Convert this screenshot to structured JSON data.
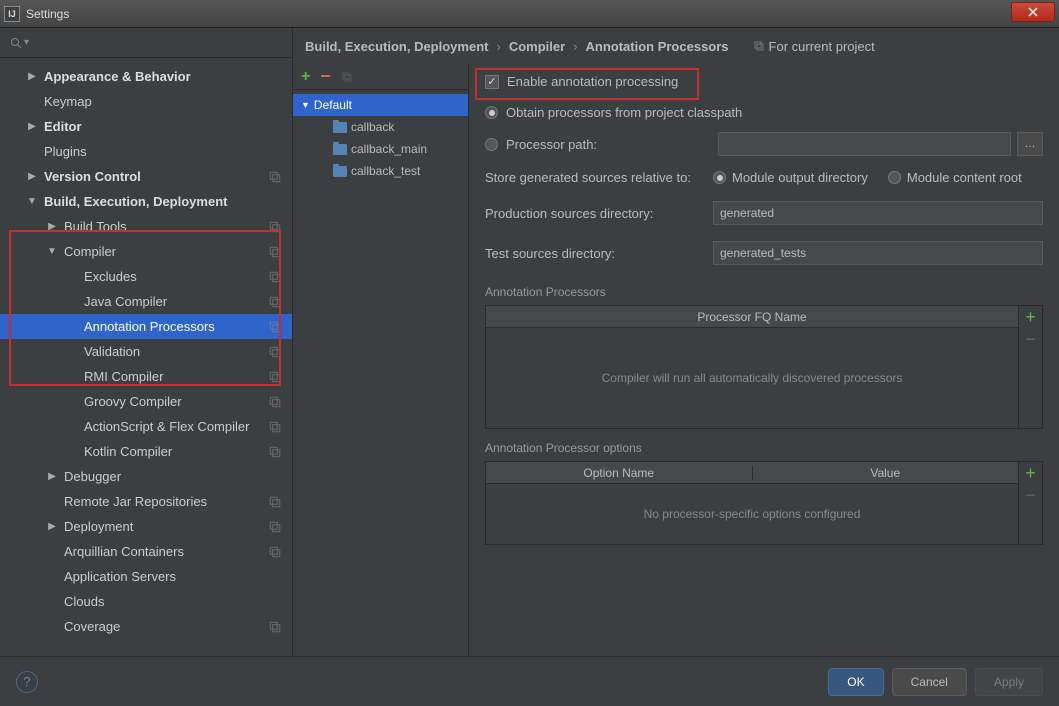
{
  "window": {
    "title": "Settings"
  },
  "search": {
    "placeholder": ""
  },
  "sidebar": {
    "items": [
      {
        "label": "Appearance & Behavior",
        "bold": true,
        "arrow": "right",
        "indent": 1
      },
      {
        "label": "Keymap",
        "indent": 1
      },
      {
        "label": "Editor",
        "bold": true,
        "arrow": "right",
        "indent": 1
      },
      {
        "label": "Plugins",
        "indent": 1
      },
      {
        "label": "Version Control",
        "bold": true,
        "arrow": "right",
        "indent": 1,
        "copy": true
      },
      {
        "label": "Build, Execution, Deployment",
        "bold": true,
        "arrow": "down",
        "indent": 1
      },
      {
        "label": "Build Tools",
        "arrow": "right",
        "indent": 2,
        "copy": true
      },
      {
        "label": "Compiler",
        "arrow": "down",
        "indent": 2,
        "copy": true
      },
      {
        "label": "Excludes",
        "indent": 3,
        "copy": true
      },
      {
        "label": "Java Compiler",
        "indent": 3,
        "copy": true
      },
      {
        "label": "Annotation Processors",
        "indent": 3,
        "copy": true,
        "selected": true
      },
      {
        "label": "Validation",
        "indent": 3,
        "copy": true
      },
      {
        "label": "RMI Compiler",
        "indent": 3,
        "copy": true
      },
      {
        "label": "Groovy Compiler",
        "indent": 3,
        "copy": true
      },
      {
        "label": "ActionScript & Flex Compiler",
        "indent": 3,
        "copy": true
      },
      {
        "label": "Kotlin Compiler",
        "indent": 3,
        "copy": true
      },
      {
        "label": "Debugger",
        "arrow": "right",
        "indent": 2
      },
      {
        "label": "Remote Jar Repositories",
        "indent": 2,
        "copy": true
      },
      {
        "label": "Deployment",
        "arrow": "right",
        "indent": 2,
        "copy": true
      },
      {
        "label": "Arquillian Containers",
        "indent": 2,
        "copy": true
      },
      {
        "label": "Application Servers",
        "indent": 2
      },
      {
        "label": "Clouds",
        "indent": 2
      },
      {
        "label": "Coverage",
        "indent": 2,
        "copy": true
      }
    ]
  },
  "breadcrumb": {
    "path": [
      "Build, Execution, Deployment",
      "Compiler",
      "Annotation Processors"
    ],
    "hint": "For current project"
  },
  "modules": {
    "default": "Default",
    "children": [
      "callback",
      "callback_main",
      "callback_test"
    ]
  },
  "panel": {
    "enable_label": "Enable annotation processing",
    "obtain_label": "Obtain processors from project classpath",
    "processor_path_label": "Processor path:",
    "store_label": "Store generated sources relative to:",
    "module_output": "Module output directory",
    "module_content": "Module content root",
    "prod_label": "Production sources directory:",
    "prod_value": "generated",
    "test_label": "Test sources directory:",
    "test_value": "generated_tests",
    "processors_section": "Annotation Processors",
    "processors_header": "Processor FQ Name",
    "processors_empty": "Compiler will run all automatically discovered processors",
    "options_section": "Annotation Processor options",
    "options_header1": "Option Name",
    "options_header2": "Value",
    "options_empty": "No processor-specific options configured"
  },
  "footer": {
    "ok": "OK",
    "cancel": "Cancel",
    "apply": "Apply"
  }
}
